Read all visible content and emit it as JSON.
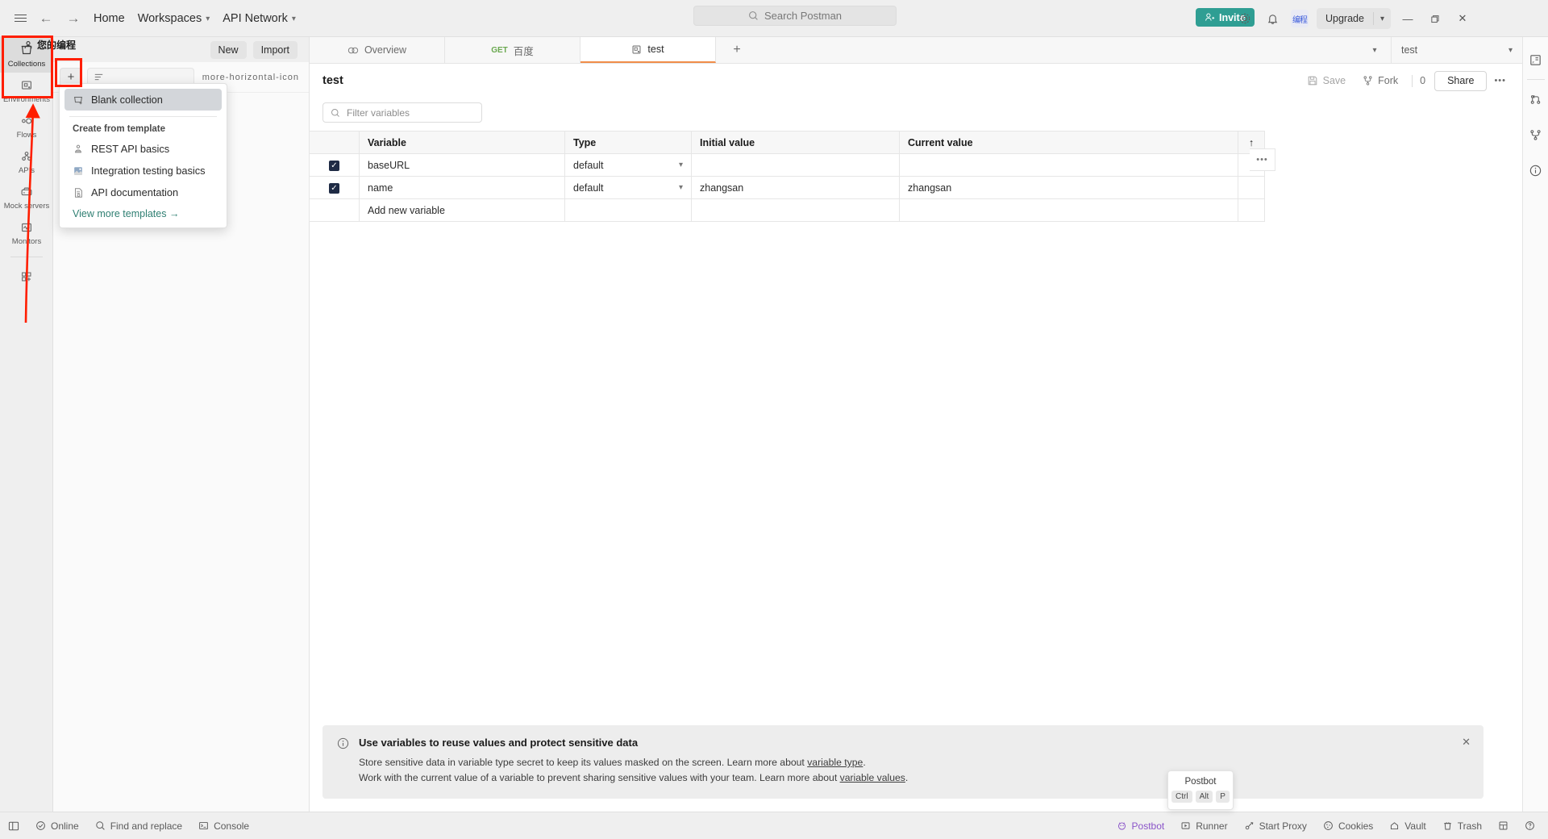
{
  "topbar": {
    "hamburger": "menu-icon",
    "back": "←",
    "forward": "→",
    "home": "Home",
    "workspaces": "Workspaces",
    "api_network": "API Network",
    "search_placeholder": "Search Postman",
    "invite": "Invite",
    "avatar_initials": "编程",
    "upgrade": "Upgrade",
    "minimize": "—",
    "maximize": "❐",
    "close": "✕"
  },
  "rail": {
    "items": [
      {
        "label": "Collections",
        "icon": "collections-icon",
        "active": true
      },
      {
        "label": "Environments",
        "icon": "environments-icon",
        "active": false
      },
      {
        "label": "Flows",
        "icon": "flows-icon",
        "active": false
      },
      {
        "label": "APIs",
        "icon": "apis-icon",
        "active": false
      },
      {
        "label": "Mock servers",
        "icon": "mock-servers-icon",
        "active": false
      },
      {
        "label": "Monitors",
        "icon": "monitors-icon",
        "active": false
      }
    ],
    "add_more": "add-panel-icon"
  },
  "sidebar": {
    "workspace_title": "您的编程",
    "new_button": "New",
    "import_button": "Import",
    "add_button": "+",
    "filter_icon": "filter-icon",
    "more_icon": "more-horizontal-icon",
    "dropdown": {
      "blank_collection": "Blank collection",
      "section_title": "Create from template",
      "templates": [
        {
          "label": "REST API basics",
          "icon": "rest-api-icon"
        },
        {
          "label": "Integration testing basics",
          "icon": "integration-testing-icon"
        },
        {
          "label": "API documentation",
          "icon": "api-documentation-icon"
        }
      ],
      "view_more": "View more templates →"
    }
  },
  "tabs": {
    "items": [
      {
        "label": "Overview",
        "icon": "overview-icon",
        "verb": "",
        "active": false
      },
      {
        "label": "百度",
        "icon": "",
        "verb": "GET",
        "active": false
      },
      {
        "label": "test",
        "icon": "collection-icon",
        "verb": "",
        "active": true
      }
    ],
    "new_tab": "+",
    "overflow_caret": "⌄",
    "environment_selected": "test",
    "env_icon": "env-quick-look-icon"
  },
  "main": {
    "title": "test",
    "save": "Save",
    "fork": "Fork",
    "fork_count": "0",
    "share": "Share",
    "more": "•••",
    "filter_placeholder": "Filter variables",
    "table": {
      "headers": [
        "",
        "Variable",
        "Type",
        "Initial value",
        "Current value"
      ],
      "sort_icon": "↑",
      "options_icon": "•••",
      "rows": [
        {
          "checked": true,
          "variable": "baseURL",
          "type": "default",
          "initial": "",
          "current": ""
        },
        {
          "checked": true,
          "variable": "name",
          "type": "default",
          "initial": "zhangsan",
          "current": "zhangsan"
        }
      ],
      "add_new": "Add new variable"
    },
    "banner": {
      "title": "Use variables to reuse values and protect sensitive data",
      "line1_pre": "Store sensitive data in variable type secret to keep its values masked on the screen. Learn more about ",
      "line1_link": "variable type",
      "line1_post": ".",
      "line2_pre": "Work with the current value of a variable to prevent sharing sensitive values with your team. Learn more about ",
      "line2_link": "variable values",
      "line2_post": ".",
      "close": "✕",
      "info_icon": "info-icon"
    }
  },
  "right_rail": {
    "items": [
      "env-quick-look-icon",
      "runner-icon",
      "fork-icon",
      "info-icon"
    ]
  },
  "status": {
    "left": [
      {
        "label": "",
        "icon": "sidebar-toggle-icon"
      },
      {
        "label": "Online",
        "icon": "online-icon"
      },
      {
        "label": "Find and replace",
        "icon": "search-icon"
      },
      {
        "label": "Console",
        "icon": "console-icon"
      }
    ],
    "right": [
      {
        "label": "Postbot",
        "icon": "postbot-icon"
      },
      {
        "label": "Runner",
        "icon": "runner-icon"
      },
      {
        "label": "Start Proxy",
        "icon": "proxy-icon"
      },
      {
        "label": "Cookies",
        "icon": "cookies-icon"
      },
      {
        "label": "Vault",
        "icon": "vault-icon"
      },
      {
        "label": "Trash",
        "icon": "trash-icon"
      },
      {
        "label": "",
        "icon": "layout-icon"
      },
      {
        "label": "",
        "icon": "help-icon"
      }
    ]
  },
  "tooltip": {
    "title": "Postbot",
    "keys": [
      "Ctrl",
      "Alt",
      "P"
    ]
  },
  "colors": {
    "accent_teal": "#2f9e93",
    "annotation_red": "#ff1e00",
    "tab_active_underline": "#f08d49",
    "postbot_purple": "#8b55c9",
    "checkbox": "#1f2b45"
  }
}
